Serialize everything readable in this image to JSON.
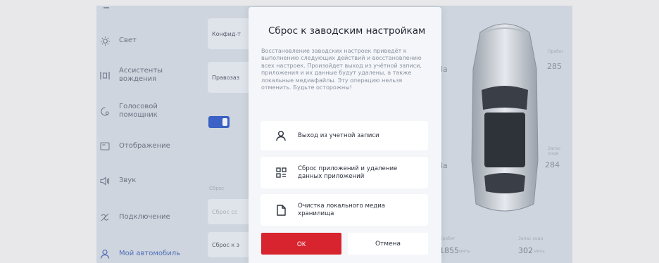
{
  "sidebar": {
    "items": [
      {
        "label": "Свет",
        "icon": "light-icon"
      },
      {
        "label": "Ассистенты вождения",
        "icon": "driver-assist-icon"
      },
      {
        "label": "Голосовой помощник",
        "icon": "voice-assistant-icon"
      },
      {
        "label": "Отображение",
        "icon": "display-icon"
      },
      {
        "label": "Звук",
        "icon": "sound-icon"
      },
      {
        "label": "Подключение",
        "icon": "connection-icon"
      },
      {
        "label": "Мой автомобиль",
        "icon": "my-car-icon",
        "active": true
      }
    ]
  },
  "background": {
    "config_label": "Конфид-т",
    "right_label": "Правозаз",
    "reset_section": "Сброс",
    "reset_faint": "Сброс сс",
    "reset_button": "Сброс к з",
    "mileage_labels": [
      "Пробег",
      "Запас хода"
    ],
    "stat_top": "285",
    "stat_mid": "284",
    "stat_mileage": "1855",
    "stat_range": "302",
    "unit": "миль",
    "cut_letter_1": "la",
    "cut_letter_2": "la"
  },
  "modal": {
    "title": "Сброс к заводским настройкам",
    "description": "Восстановление заводских настроек приведёт к выполнению следующих действий и восстановлению всех настроек. Произойдет выход из учётной записи, приложения и их данные будут удалены, а также локальные медиафайлы. Эту операцию нельзя отменить. Будьте осторожны!",
    "options": [
      {
        "label": "Выход из учетной записи",
        "icon": "user-icon"
      },
      {
        "label": "Сброс приложений и удаление данных приложений",
        "icon": "apps-icon"
      },
      {
        "label": "Очистка локального медиа хранилища",
        "icon": "file-icon"
      }
    ],
    "ok_label": "ОК",
    "cancel_label": "Отмена"
  },
  "colors": {
    "accent": "#3b62c4",
    "ok_button": "#d8242e",
    "modal_bg": "#f4f6f9"
  }
}
